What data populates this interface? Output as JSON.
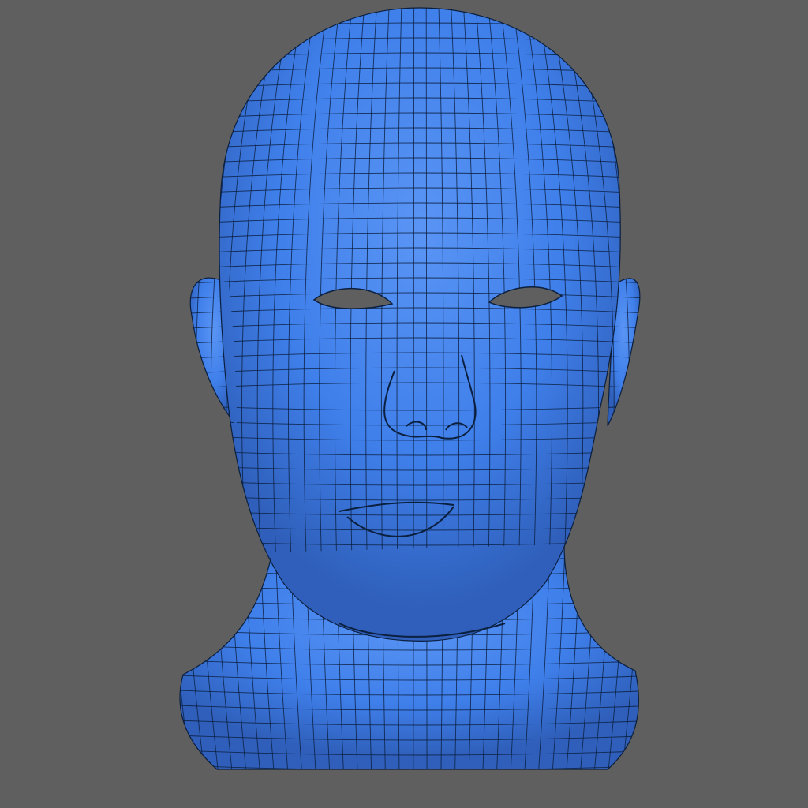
{
  "viewport": {
    "background_color": "#5f5f5f",
    "mesh_fill_color": "#3f7fea",
    "mesh_shadow_color": "#2f5fba",
    "mesh_highlight_color": "#5a95f5",
    "wireframe_color": "#0b1f3e",
    "cavity_color": "#5f5f5f",
    "subject": "head-mesh-icon",
    "grid_spacing": 19
  }
}
